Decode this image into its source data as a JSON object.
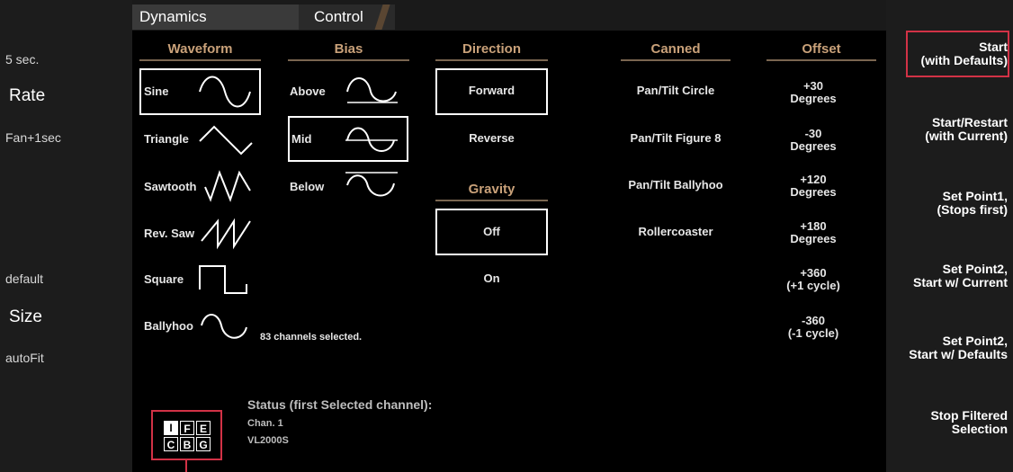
{
  "tabs": [
    {
      "label": "Dynamics"
    },
    {
      "label": "Control"
    }
  ],
  "left": {
    "duration": "5 sec.",
    "rate_label": "Rate",
    "rate_mode": "Fan+1sec",
    "size_default": "default",
    "size_label": "Size",
    "size_mode": "autoFit"
  },
  "headers": {
    "waveform": "Waveform",
    "bias": "Bias",
    "direction": "Direction",
    "gravity": "Gravity",
    "canned": "Canned",
    "offset": "Offset"
  },
  "waveforms": [
    {
      "label": "Sine",
      "icon": "sine-wave-icon",
      "selected": true
    },
    {
      "label": "Triangle",
      "icon": "triangle-wave-icon",
      "selected": false
    },
    {
      "label": "Sawtooth",
      "icon": "sawtooth-wave-icon",
      "selected": false
    },
    {
      "label": "Rev. Saw",
      "icon": "reverse-sawtooth-wave-icon",
      "selected": false
    },
    {
      "label": "Square",
      "icon": "square-wave-icon",
      "selected": false
    },
    {
      "label": "Ballyhoo",
      "icon": "ballyhoo-wave-icon",
      "selected": false
    }
  ],
  "bias": [
    {
      "label": "Above",
      "icon": "bias-above-icon",
      "selected": false
    },
    {
      "label": "Mid",
      "icon": "bias-mid-icon",
      "selected": true
    },
    {
      "label": "Below",
      "icon": "bias-below-icon",
      "selected": false
    }
  ],
  "direction": [
    {
      "label": "Forward",
      "selected": true
    },
    {
      "label": "Reverse",
      "selected": false
    }
  ],
  "gravity": [
    {
      "label": "Off",
      "selected": true
    },
    {
      "label": "On",
      "selected": false
    }
  ],
  "canned": [
    {
      "label": "Pan/Tilt Circle"
    },
    {
      "label": "Pan/Tilt Figure 8"
    },
    {
      "label": "Pan/Tilt Ballyhoo"
    },
    {
      "label": "Rollercoaster"
    }
  ],
  "offset": [
    {
      "line1": "+30",
      "line2": "Degrees"
    },
    {
      "line1": "-30",
      "line2": "Degrees"
    },
    {
      "line1": "+120",
      "line2": "Degrees"
    },
    {
      "line1": "+180",
      "line2": "Degrees"
    },
    {
      "line1": "+360",
      "line2": "(+1 cycle)"
    },
    {
      "line1": "-360",
      "line2": "(-1 cycle)"
    }
  ],
  "selection_count": "83 channels selected.",
  "status": {
    "title": "Status (first Selected channel):",
    "channel": "Chan. 1",
    "fixture": "VL2000S"
  },
  "status_grid": [
    [
      {
        "letter": "I",
        "on": true
      },
      {
        "letter": "F",
        "on": false
      },
      {
        "letter": "E",
        "on": false
      }
    ],
    [
      {
        "letter": "C",
        "on": false
      },
      {
        "letter": "B",
        "on": false
      },
      {
        "letter": "G",
        "on": false
      }
    ]
  ],
  "actions": [
    {
      "label": "Start\n(with Defaults)",
      "highlight": true
    },
    {
      "label": "Start/Restart\n(with Current)",
      "highlight": false
    },
    {
      "label": "Set Point1,\n(Stops first)",
      "highlight": false
    },
    {
      "label": "Set Point2,\nStart w/ Current",
      "highlight": false
    },
    {
      "label": "Set Point2,\nStart w/ Defaults",
      "highlight": false
    },
    {
      "label": "Stop Filtered\nSelection",
      "highlight": false
    }
  ],
  "colors": {
    "accent": "#c9a179",
    "highlight": "#d23246",
    "panel": "#1c1c1c"
  }
}
